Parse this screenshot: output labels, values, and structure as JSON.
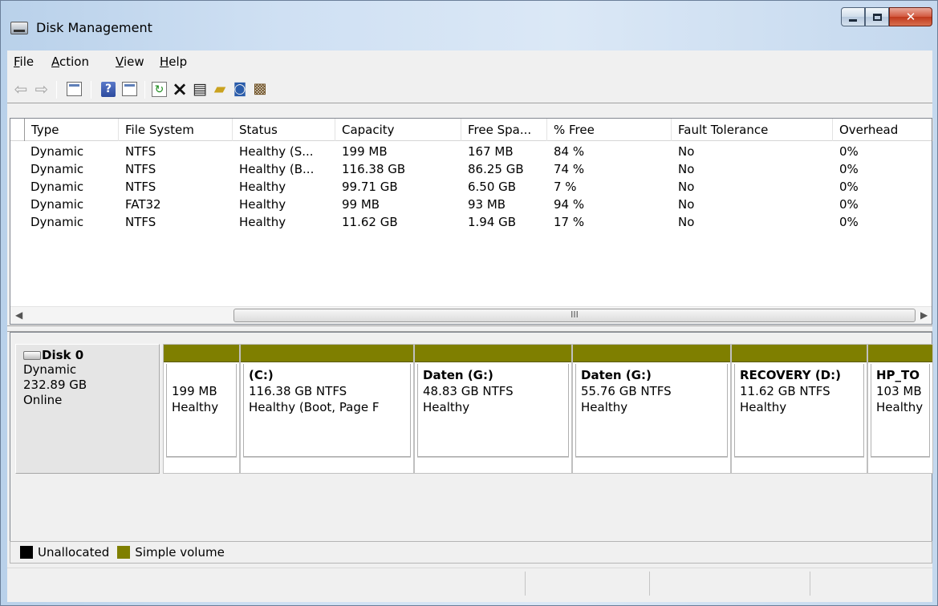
{
  "window": {
    "title": "Disk Management"
  },
  "menu": [
    {
      "pre": "",
      "key": "F",
      "post": "ile"
    },
    {
      "pre": "",
      "key": "A",
      "post": "ction"
    },
    {
      "pre": "",
      "key": "V",
      "post": "iew"
    },
    {
      "pre": "",
      "key": "H",
      "post": "elp"
    }
  ],
  "toolbar": [
    "back-icon",
    "forward-icon",
    "show-hide-console-tree-icon",
    "help-icon",
    "show-action-pane-icon",
    "refresh-icon",
    "delete-icon",
    "properties-icon",
    "open-icon",
    "explore-icon",
    "rescan-disks-icon"
  ],
  "volumes": {
    "columns": [
      "Type",
      "File System",
      "Status",
      "Capacity",
      "Free Spa...",
      "% Free",
      "Fault Tolerance",
      "Overhead"
    ],
    "rows": [
      [
        "Dynamic",
        "NTFS",
        "Healthy (S...",
        "199 MB",
        "167 MB",
        "84 %",
        "No",
        "0%"
      ],
      [
        "Dynamic",
        "NTFS",
        "Healthy (B...",
        "116.38 GB",
        "86.25 GB",
        "74 %",
        "No",
        "0%"
      ],
      [
        "Dynamic",
        "NTFS",
        "Healthy",
        "99.71 GB",
        "6.50 GB",
        "7 %",
        "No",
        "0%"
      ],
      [
        "Dynamic",
        "FAT32",
        "Healthy",
        "99 MB",
        "93 MB",
        "94 %",
        "No",
        "0%"
      ],
      [
        "Dynamic",
        "NTFS",
        "Healthy",
        "11.62 GB",
        "1.94 GB",
        "17 %",
        "No",
        "0%"
      ]
    ],
    "scroll_thumb": "III"
  },
  "disk": {
    "name": "Disk 0",
    "type": "Dynamic",
    "size": "232.89 GB",
    "state": "Online",
    "partitions": [
      {
        "name": "",
        "size": "199 MB",
        "status": "Healthy"
      },
      {
        "name": "(C:)",
        "size": "116.38 GB NTFS",
        "status": "Healthy (Boot, Page F"
      },
      {
        "name": "Daten  (G:)",
        "size": "48.83 GB NTFS",
        "status": "Healthy"
      },
      {
        "name": "Daten  (G:)",
        "size": "55.76 GB NTFS",
        "status": "Healthy"
      },
      {
        "name": "RECOVERY  (D:)",
        "size": "11.62 GB NTFS",
        "status": "Healthy"
      },
      {
        "name": "HP_TO",
        "size": "103 MB",
        "status": "Healthy"
      }
    ]
  },
  "legend": [
    {
      "label": "Unallocated",
      "color": "#000000"
    },
    {
      "label": "Simple volume",
      "color": "#7f7f00"
    }
  ],
  "colors": {
    "simple_volume": "#7f7f00",
    "unallocated": "#000000",
    "close_button": "#c0391d"
  }
}
